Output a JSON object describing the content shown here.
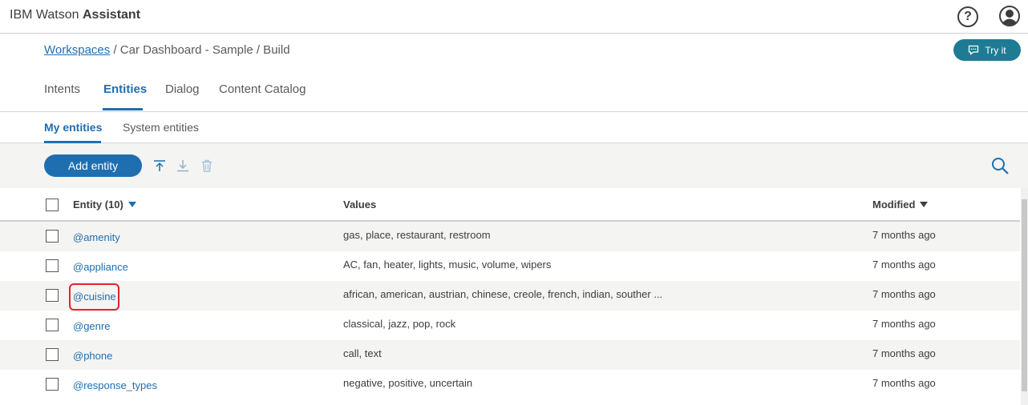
{
  "header": {
    "brand_prefix": "IBM Watson",
    "brand_strong": "Assistant",
    "help_glyph": "?"
  },
  "breadcrumb": {
    "link": "Workspaces",
    "rest": "/ Car Dashboard - Sample / Build"
  },
  "try_it": {
    "label": "Try it"
  },
  "tabs": [
    {
      "label": "Intents"
    },
    {
      "label": "Entities"
    },
    {
      "label": "Dialog"
    },
    {
      "label": "Content Catalog"
    }
  ],
  "subtabs": [
    {
      "label": "My entities"
    },
    {
      "label": "System entities"
    }
  ],
  "toolbar": {
    "add_label": "Add entity",
    "icons": [
      "upload-icon",
      "download-icon",
      "trash-icon",
      "search-icon"
    ]
  },
  "table": {
    "headers": {
      "entity": "Entity (10)",
      "values": "Values",
      "modified": "Modified"
    },
    "rows": [
      {
        "entity": "@amenity",
        "values": "gas, place, restaurant, restroom",
        "modified": "7 months ago"
      },
      {
        "entity": "@appliance",
        "values": "AC, fan, heater, lights, music, volume, wipers",
        "modified": "7 months ago"
      },
      {
        "entity": "@cuisine",
        "values": "african, american, austrian, chinese, creole, french, indian, souther ...",
        "modified": "7 months ago"
      },
      {
        "entity": "@genre",
        "values": "classical, jazz, pop, rock",
        "modified": "7 months ago"
      },
      {
        "entity": "@phone",
        "values": "call, text",
        "modified": "7 months ago"
      },
      {
        "entity": "@response_types",
        "values": "negative, positive, uncertain",
        "modified": "7 months ago"
      }
    ]
  },
  "colors": {
    "accent": "#1f6fb0",
    "try_it_bg": "#1d7c94",
    "highlight": "#e0242e",
    "row_alt": "#f4f4f2"
  }
}
